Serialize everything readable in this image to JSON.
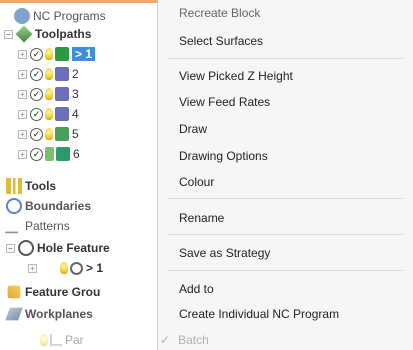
{
  "tree": {
    "nc_programs": "NC Programs",
    "toolpaths": "Toolpaths",
    "toolpath_items": [
      {
        "label": "> 1",
        "selected": true,
        "color": "#2c9a3f"
      },
      {
        "label": "2",
        "selected": false,
        "color": "#6b6fb8"
      },
      {
        "label": "3",
        "selected": false,
        "color": "#6b6fb8"
      },
      {
        "label": "4",
        "selected": false,
        "color": "#6b6fb8"
      },
      {
        "label": "5",
        "selected": false,
        "color": "#4aa05a"
      },
      {
        "label": "6",
        "selected": false,
        "color": "#2a9a6a"
      }
    ],
    "tools": "Tools",
    "boundaries": "Boundaries",
    "patterns": "Patterns",
    "hole_features": "Hole Feature",
    "hole_child": "> 1",
    "feature_groups": "Feature Grou",
    "workplanes": "Workplanes",
    "par": "Par"
  },
  "menu": {
    "recreate_block": "Recreate Block",
    "select_surfaces": "Select Surfaces",
    "view_picked_z": "View Picked Z Height",
    "view_feed_rates": "View Feed Rates",
    "draw": "Draw",
    "drawing_options": "Drawing Options",
    "colour": "Colour",
    "rename": "Rename",
    "save_as_strategy": "Save as Strategy",
    "add_to": "Add to",
    "create_individual_nc": "Create Individual NC Program",
    "batch": "Batch"
  },
  "colors": {
    "selection": "#3b8fdc",
    "menu_bg": "#f6f6f6",
    "accent_top": "#f2a86a"
  }
}
